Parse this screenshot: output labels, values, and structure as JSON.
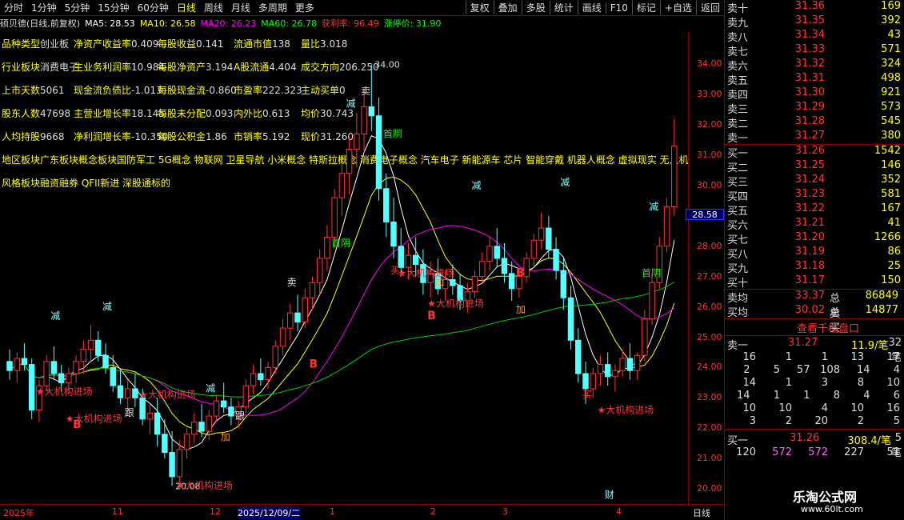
{
  "toolbar": {
    "timeframes": [
      "分时",
      "1分钟",
      "5分钟",
      "15分钟",
      "60分钟",
      "日线",
      "周线",
      "月线",
      "多周期",
      "更多"
    ],
    "active": "日线",
    "buttons": [
      "复权",
      "叠加",
      "多股",
      "统计",
      "画线",
      "F10",
      "标记",
      "+自选",
      "返回"
    ]
  },
  "legend": {
    "title": "硕贝德(日线,前复权)",
    "items": [
      {
        "t": "MA5: 28.53",
        "c": "#fff"
      },
      {
        "t": "MA10: 26.58",
        "c": "#ff0"
      },
      {
        "t": "MA20: 26.23",
        "c": "#f0f"
      },
      {
        "t": "MA60: 26.78",
        "c": "#0f0"
      },
      {
        "t": "获利率: 96.49",
        "c": "#f33"
      },
      {
        "t": "涨停价: 31.90",
        "c": "#0f0"
      }
    ]
  },
  "info_rows": [
    [
      {
        "k": "品种类型",
        "v": "创业板"
      },
      {
        "k": "净资产收益率",
        "v": "0.409"
      },
      {
        "k": "每股收益",
        "v": "0.141"
      },
      {
        "k": "流通市值",
        "v": "138"
      },
      {
        "k": "量比",
        "v": "3.018"
      }
    ],
    [
      {
        "k": "行业板块",
        "v": "消费电子"
      },
      {
        "k": "主业务利润率",
        "v": "10.984"
      },
      {
        "k": "每股净资产",
        "v": "3.194"
      },
      {
        "k": "A股流通",
        "v": "4.404"
      },
      {
        "k": "成交方向",
        "v": "206.250"
      }
    ],
    [
      {
        "k": "上市天数",
        "v": "5061"
      },
      {
        "k": "现金流负债比",
        "v": "-1.013"
      },
      {
        "k": "每股现金流",
        "v": "-0.860"
      },
      {
        "k": "市盈率",
        "v": "222.323"
      },
      {
        "k": "主动买单",
        "v": "0"
      }
    ],
    [
      {
        "k": "股东人数",
        "v": "47698"
      },
      {
        "k": "主营业增长率",
        "v": "18.145"
      },
      {
        "k": "每股未分配",
        "v": "0.093"
      },
      {
        "k": "内外比",
        "v": "0.613"
      },
      {
        "k": "均价",
        "v": "30.743"
      }
    ],
    [
      {
        "k": "人均持股",
        "v": "9668"
      },
      {
        "k": "净利润增长率",
        "v": "-10.350"
      },
      {
        "k": "每股公积金",
        "v": "1.86"
      },
      {
        "k": "市销率",
        "v": "5.192"
      },
      {
        "k": "现价",
        "v": "31.260"
      }
    ]
  ],
  "region_line": "地区板块广东板块概念板块国防军工 5G概念 物联网 卫星导航 小米概念 特斯拉概念 消费电子概念 汽车电子 新能源车 芯片 智能穿戴 机器人概念 虚拟现实 无人机 无",
  "style_line": "风格板块融资融券 QFII新进 深股通标的",
  "chart_data": {
    "type": "candlestick",
    "ylim": [
      19.5,
      34.8
    ],
    "yticks": [
      20,
      21,
      22,
      23,
      24,
      25,
      26,
      27,
      28,
      29,
      30,
      31,
      32,
      33,
      34
    ],
    "ytick_labels": [
      "20.00",
      "21.00",
      "22.00",
      "23.00",
      "24.00",
      "25.00",
      "26.00",
      "27.00",
      "28.00",
      "29.00",
      "30.00",
      "31.00",
      "32.00",
      "33.00",
      "34.00"
    ],
    "current_price": "28.58",
    "x_labels": [
      "2025年",
      "11",
      "12",
      "2025/12/09/二",
      "1",
      "2",
      "3",
      "4",
      "日线"
    ],
    "ohlc": [
      [
        24.2,
        24.6,
        23.6,
        23.9
      ],
      [
        23.9,
        24.5,
        23.5,
        24.3
      ],
      [
        24.3,
        24.8,
        23.9,
        24.1
      ],
      [
        24.1,
        24.3,
        22.3,
        22.6
      ],
      [
        22.6,
        23.6,
        22.2,
        23.4
      ],
      [
        23.4,
        24.4,
        23.2,
        24.2
      ],
      [
        24.2,
        24.7,
        23.6,
        23.8
      ],
      [
        23.8,
        24.1,
        23.2,
        23.5
      ],
      [
        23.5,
        24.0,
        23.1,
        23.8
      ],
      [
        23.8,
        24.4,
        23.5,
        24.2
      ],
      [
        24.2,
        24.9,
        23.8,
        24.6
      ],
      [
        24.6,
        25.4,
        24.2,
        24.9
      ],
      [
        24.9,
        25.2,
        24.2,
        24.4
      ],
      [
        24.4,
        24.8,
        23.8,
        24.0
      ],
      [
        24.0,
        24.4,
        23.2,
        23.4
      ],
      [
        23.4,
        23.9,
        22.8,
        23.0
      ],
      [
        23.0,
        23.6,
        22.5,
        23.3
      ],
      [
        23.3,
        23.8,
        22.7,
        23.0
      ],
      [
        23.0,
        23.3,
        22.1,
        22.3
      ],
      [
        22.3,
        22.8,
        21.8,
        22.5
      ],
      [
        22.5,
        23.0,
        21.4,
        21.8
      ],
      [
        21.8,
        22.3,
        21.0,
        21.2
      ],
      [
        21.2,
        21.9,
        20.1,
        20.4
      ],
      [
        20.4,
        21.6,
        20.2,
        21.3
      ],
      [
        21.3,
        22.0,
        21.0,
        21.8
      ],
      [
        21.8,
        22.5,
        21.5,
        22.2
      ],
      [
        22.2,
        22.8,
        21.7,
        21.9
      ],
      [
        21.9,
        22.6,
        21.6,
        22.4
      ],
      [
        22.4,
        23.1,
        22.2,
        22.9
      ],
      [
        22.9,
        23.5,
        22.5,
        22.7
      ],
      [
        22.7,
        23.0,
        22.1,
        22.4
      ],
      [
        22.4,
        22.9,
        22.0,
        22.7
      ],
      [
        22.7,
        23.6,
        22.5,
        23.4
      ],
      [
        23.4,
        24.1,
        23.1,
        23.8
      ],
      [
        23.8,
        24.3,
        23.4,
        23.6
      ],
      [
        23.6,
        24.2,
        23.3,
        24.0
      ],
      [
        24.0,
        24.9,
        23.8,
        24.7
      ],
      [
        24.7,
        25.6,
        24.4,
        25.3
      ],
      [
        25.3,
        26.1,
        24.9,
        25.8
      ],
      [
        25.8,
        26.4,
        25.2,
        25.5
      ],
      [
        25.5,
        26.6,
        25.3,
        26.3
      ],
      [
        26.3,
        27.0,
        25.9,
        26.8
      ],
      [
        26.8,
        27.9,
        26.4,
        27.6
      ],
      [
        27.6,
        28.7,
        27.2,
        28.3
      ],
      [
        28.3,
        29.9,
        28.0,
        29.6
      ],
      [
        29.6,
        31.0,
        29.0,
        30.4
      ],
      [
        30.4,
        31.6,
        29.7,
        31.2
      ],
      [
        31.2,
        32.4,
        30.6,
        31.7
      ],
      [
        31.7,
        33.2,
        31.1,
        32.6
      ],
      [
        32.6,
        34.0,
        31.8,
        32.3
      ],
      [
        32.3,
        32.9,
        29.5,
        29.9
      ],
      [
        29.9,
        30.4,
        28.3,
        28.8
      ],
      [
        28.8,
        29.6,
        27.6,
        28.0
      ],
      [
        28.0,
        28.6,
        27.0,
        27.3
      ],
      [
        27.3,
        28.1,
        26.9,
        27.7
      ],
      [
        27.7,
        28.3,
        27.0,
        27.4
      ],
      [
        27.4,
        27.9,
        26.4,
        26.8
      ],
      [
        26.8,
        27.5,
        26.3,
        27.1
      ],
      [
        27.1,
        27.6,
        26.4,
        26.6
      ],
      [
        26.6,
        27.2,
        26.2,
        26.9
      ],
      [
        26.9,
        27.4,
        26.4,
        26.7
      ],
      [
        26.7,
        27.1,
        25.9,
        26.2
      ],
      [
        26.2,
        26.8,
        25.8,
        26.5
      ],
      [
        26.5,
        27.2,
        26.3,
        27.0
      ],
      [
        27.0,
        27.8,
        26.8,
        27.5
      ],
      [
        27.5,
        28.3,
        27.2,
        28.0
      ],
      [
        28.0,
        28.6,
        27.3,
        27.6
      ],
      [
        27.6,
        28.1,
        26.8,
        27.1
      ],
      [
        27.1,
        27.5,
        26.2,
        26.6
      ],
      [
        26.6,
        27.3,
        26.3,
        27.0
      ],
      [
        27.0,
        27.8,
        26.8,
        27.6
      ],
      [
        27.6,
        28.4,
        27.3,
        28.2
      ],
      [
        28.2,
        29.1,
        27.9,
        28.6
      ],
      [
        28.6,
        29.0,
        27.6,
        27.9
      ],
      [
        27.9,
        28.3,
        26.9,
        27.2
      ],
      [
        27.2,
        27.6,
        25.9,
        26.3
      ],
      [
        26.3,
        26.7,
        24.6,
        24.9
      ],
      [
        24.9,
        25.3,
        23.5,
        23.8
      ],
      [
        23.8,
        24.2,
        22.8,
        23.3
      ],
      [
        23.3,
        24.0,
        23.0,
        23.8
      ],
      [
        23.8,
        24.4,
        23.4,
        24.1
      ],
      [
        24.1,
        24.5,
        23.4,
        23.7
      ],
      [
        23.7,
        24.1,
        23.2,
        23.9
      ],
      [
        23.9,
        24.6,
        23.7,
        24.3
      ],
      [
        24.3,
        24.8,
        23.6,
        23.9
      ],
      [
        23.9,
        24.5,
        23.6,
        24.4
      ],
      [
        24.4,
        25.9,
        24.2,
        25.6
      ],
      [
        25.6,
        27.1,
        25.4,
        26.8
      ],
      [
        26.8,
        28.3,
        26.6,
        28.0
      ],
      [
        28.0,
        29.6,
        27.8,
        29.3
      ],
      [
        29.3,
        32.2,
        29.0,
        31.3
      ]
    ],
    "ma": {
      "MA5": {
        "color": "#ffffff",
        "width": 1
      },
      "MA10": {
        "color": "#ffff00",
        "width": 1
      },
      "MA20": {
        "color": "#ff00ff",
        "width": 1
      },
      "MA60": {
        "color": "#00cc00",
        "width": 1
      }
    },
    "hi_label": "34.00",
    "lo_label": "20.08",
    "annotations": [
      {
        "t": "减",
        "c": "#8ff",
        "i": 6,
        "p": 25.6
      },
      {
        "t": "减",
        "c": "#8ff",
        "i": 13,
        "p": 25.9
      },
      {
        "t": "跟",
        "c": "#ddd",
        "i": 16,
        "p": 22.4
      },
      {
        "t": "跟",
        "c": "#ddd",
        "i": 31,
        "p": 22.3
      },
      {
        "t": "加",
        "c": "#f93",
        "i": 29,
        "p": 21.6
      },
      {
        "t": "减",
        "c": "#8ff",
        "i": 27,
        "p": 23.2
      },
      {
        "t": "卖",
        "c": "#ddd",
        "i": 38,
        "p": 26.7
      },
      {
        "t": "卖",
        "c": "#ddd",
        "i": 48,
        "p": 33.0
      },
      {
        "t": "减",
        "c": "#8ff",
        "i": 46,
        "p": 32.6
      },
      {
        "t": "首阴",
        "c": "#0f0",
        "i": 51,
        "p": 31.6
      },
      {
        "t": "首阴",
        "c": "#0f0",
        "i": 44,
        "p": 28.0
      },
      {
        "t": "买",
        "c": "#f33",
        "i": 52,
        "p": 27.1
      },
      {
        "t": "加",
        "c": "#f93",
        "i": 58,
        "p": 26.7
      },
      {
        "t": "减",
        "c": "#8ff",
        "i": 63,
        "p": 29.9
      },
      {
        "t": "加",
        "c": "#f93",
        "i": 69,
        "p": 25.8
      },
      {
        "t": "减",
        "c": "#8ff",
        "i": 75,
        "p": 30.0
      },
      {
        "t": "买",
        "c": "#f33",
        "i": 78,
        "p": 23.0
      },
      {
        "t": "减",
        "c": "#8ff",
        "i": 87,
        "p": 29.2
      },
      {
        "t": "首阴",
        "c": "#0f0",
        "i": 86,
        "p": 27.0
      },
      {
        "t": "财",
        "c": "#8ff",
        "i": 81,
        "p": 19.7
      },
      {
        "t": "B",
        "c": "#f33",
        "i": 9,
        "p": 22.0
      },
      {
        "t": "B",
        "c": "#f33",
        "i": 41,
        "p": 24.0
      },
      {
        "t": "B",
        "c": "#f33",
        "i": 57,
        "p": 25.6
      },
      {
        "t": "B",
        "c": "#f33",
        "i": 69,
        "p": 27.0
      },
      {
        "t": "★大机构进场",
        "c": "#f33",
        "i": 8,
        "p": 22.2
      },
      {
        "t": "★大机构进场",
        "c": "#f33",
        "i": 23,
        "p": 20.0
      },
      {
        "t": "★大机构进场",
        "c": "#f33",
        "i": 57,
        "p": 26.0
      },
      {
        "t": "★大机构进场",
        "c": "#f33",
        "i": 80,
        "p": 22.5
      },
      {
        "t": "★大机构进场",
        "c": "#f33",
        "i": 18,
        "p": 23.0
      },
      {
        "t": "★大机构进场",
        "c": "#f33",
        "i": 4,
        "p": 23.1
      },
      {
        "t": "★大机构进场",
        "c": "#f33",
        "i": 53,
        "p": 27.0
      }
    ]
  },
  "orderbook": {
    "sells": [
      [
        "卖十",
        "31.36",
        "169"
      ],
      [
        "卖九",
        "31.35",
        "392"
      ],
      [
        "卖八",
        "31.34",
        "43"
      ],
      [
        "卖七",
        "31.33",
        "571"
      ],
      [
        "卖六",
        "31.32",
        "324"
      ],
      [
        "卖五",
        "31.31",
        "498"
      ],
      [
        "卖四",
        "31.30",
        "921"
      ],
      [
        "卖三",
        "31.29",
        "573"
      ],
      [
        "卖二",
        "31.28",
        "545"
      ],
      [
        "卖一",
        "31.27",
        "380"
      ]
    ],
    "buys": [
      [
        "买一",
        "31.26",
        "1542"
      ],
      [
        "买二",
        "31.25",
        "146"
      ],
      [
        "买三",
        "31.24",
        "352"
      ],
      [
        "买四",
        "31.23",
        "581"
      ],
      [
        "买五",
        "31.22",
        "167"
      ],
      [
        "买六",
        "31.21",
        "41"
      ],
      [
        "买七",
        "31.20",
        "1266"
      ],
      [
        "买八",
        "31.19",
        "86"
      ],
      [
        "买九",
        "31.18",
        "25"
      ],
      [
        "买十",
        "31.17",
        "150"
      ]
    ],
    "avg_sell": "33.37",
    "total_sell": "86849",
    "avg_buy": "30.02",
    "total_buy": "14877",
    "labels": {
      "avg_sell": "卖均",
      "avg_buy": "买均",
      "total_sell": "总卖",
      "total_buy": "总买"
    },
    "button": "查看千档盘口",
    "tick_sell": {
      "label": "卖一",
      "price": "31.27",
      "per": "11.9/笔",
      "count": "32笔",
      "rows": [
        [
          "16",
          "1",
          "1",
          "13",
          "17"
        ],
        [
          "2",
          "5",
          "57",
          "108",
          "14",
          "4"
        ],
        [
          "14",
          "1",
          "3",
          "8",
          "10"
        ],
        [
          "14",
          "1",
          "1",
          "8",
          "4",
          "6"
        ],
        [
          "10",
          "10",
          "4",
          "10",
          "16"
        ],
        [
          "3",
          "2",
          "20",
          "2",
          "5"
        ]
      ]
    },
    "tick_buy": {
      "label": "买一",
      "price": "31.26",
      "per": "308.4/笔",
      "count": "5笔",
      "rows": [
        [
          "120",
          "572",
          "572",
          "227",
          "51"
        ]
      ]
    }
  },
  "watermark": {
    "line1": "乐淘公式网",
    "line2": "www.60lt.com"
  }
}
